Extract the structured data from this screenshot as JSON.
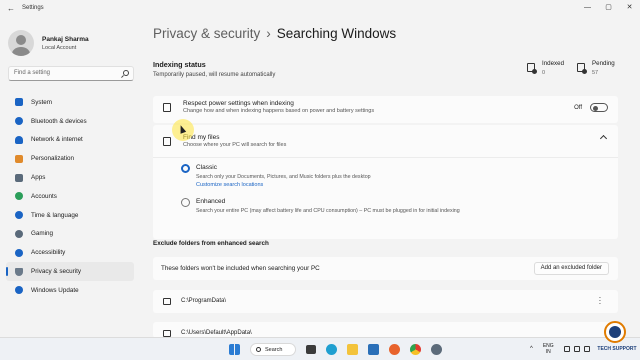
{
  "window": {
    "title": "Settings",
    "back_glyph": "←",
    "minimize_glyph": "—",
    "maximize_glyph": "▢",
    "close_glyph": "✕"
  },
  "profile": {
    "name": "Pankaj Sharma",
    "account": "Local Account"
  },
  "search": {
    "placeholder": "Find a setting"
  },
  "sidebar": {
    "items": [
      {
        "label": "System",
        "icon": "system-icon",
        "color": "#1a64c4"
      },
      {
        "label": "Bluetooth & devices",
        "icon": "bluetooth-icon",
        "color": "#1a64c4"
      },
      {
        "label": "Network & internet",
        "icon": "wifi-icon",
        "color": "#1a64c4"
      },
      {
        "label": "Personalization",
        "icon": "brush-icon",
        "color": "#e08a2b"
      },
      {
        "label": "Apps",
        "icon": "apps-icon",
        "color": "#5a6a7a"
      },
      {
        "label": "Accounts",
        "icon": "account-icon",
        "color": "#2b9e5a"
      },
      {
        "label": "Time & language",
        "icon": "globe-icon",
        "color": "#1a64c4"
      },
      {
        "label": "Gaming",
        "icon": "gamepad-icon",
        "color": "#5a6a7a"
      },
      {
        "label": "Accessibility",
        "icon": "accessibility-icon",
        "color": "#1a64c4"
      },
      {
        "label": "Privacy & security",
        "icon": "shield-icon",
        "color": "#6b7a8a"
      },
      {
        "label": "Windows Update",
        "icon": "update-icon",
        "color": "#1a64c4"
      }
    ],
    "active_index": 9
  },
  "breadcrumb": {
    "parent": "Privacy & security",
    "separator": "›",
    "current": "Searching Windows"
  },
  "indexing": {
    "heading": "Indexing status",
    "status": "Temporarily paused, will resume automatically",
    "indexed_label": "Indexed",
    "indexed_value": "0",
    "pending_label": "Pending",
    "pending_value": "57"
  },
  "power": {
    "title": "Respect power settings when indexing",
    "desc": "Change how and when indexing happens based on power and battery settings",
    "state": "Off"
  },
  "find_files": {
    "title": "Find my files",
    "desc": "Choose where your PC will search for files",
    "options": [
      {
        "title": "Classic",
        "desc": "Search only your Documents, Pictures, and Music folders plus the desktop",
        "link": "Customize search locations",
        "selected": true
      },
      {
        "title": "Enhanced",
        "desc": "Search your entire PC (may affect battery life and CPU consumption) – PC must be plugged in for initial indexing",
        "selected": false
      }
    ]
  },
  "exclude": {
    "heading": "Exclude folders from enhanced search",
    "text": "These folders won't be included when searching your PC",
    "button": "Add an excluded folder",
    "folders": [
      "C:\\ProgramData\\",
      "C:\\Users\\Default\\AppData\\"
    ]
  },
  "taskbar": {
    "search_label": "Search",
    "lang_line1": "ENG",
    "lang_line2": "IN"
  },
  "watermark": {
    "text": "TECH SUPPORT"
  }
}
